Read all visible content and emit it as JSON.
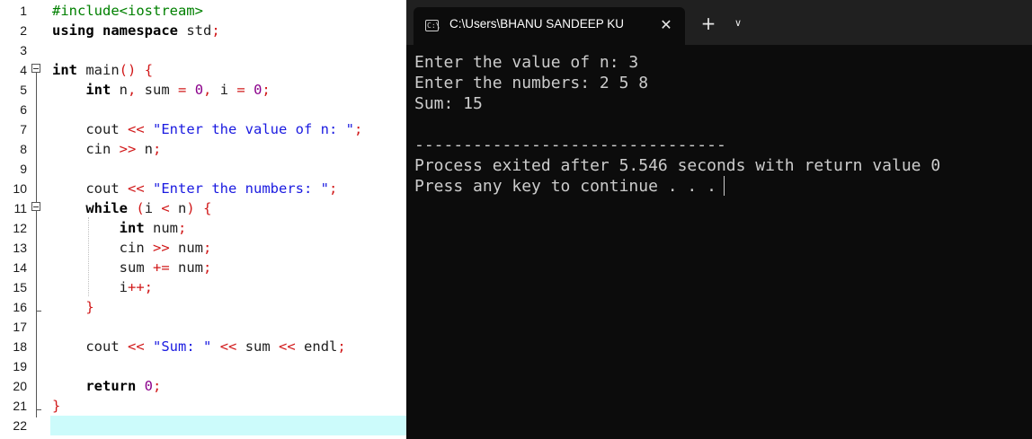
{
  "editor": {
    "lines": [
      {
        "n": "1",
        "tokens": [
          {
            "t": "#include<iostream>",
            "c": "pp"
          }
        ]
      },
      {
        "n": "2",
        "tokens": [
          {
            "t": "using namespace",
            "c": "kw"
          },
          {
            "t": " std",
            "c": "id"
          },
          {
            "t": ";",
            "c": "op"
          }
        ]
      },
      {
        "n": "3",
        "tokens": []
      },
      {
        "n": "4",
        "tokens": [
          {
            "t": "int",
            "c": "kw"
          },
          {
            "t": " main",
            "c": "id"
          },
          {
            "t": "()",
            "c": "op"
          },
          {
            "t": " ",
            "c": "id"
          },
          {
            "t": "{",
            "c": "op"
          }
        ]
      },
      {
        "n": "5",
        "tokens": [
          {
            "t": "    ",
            "c": "id"
          },
          {
            "t": "int",
            "c": "kw"
          },
          {
            "t": " n",
            "c": "id"
          },
          {
            "t": ",",
            "c": "op"
          },
          {
            "t": " sum ",
            "c": "id"
          },
          {
            "t": "=",
            "c": "op"
          },
          {
            "t": " ",
            "c": "id"
          },
          {
            "t": "0",
            "c": "num"
          },
          {
            "t": ",",
            "c": "op"
          },
          {
            "t": " i ",
            "c": "id"
          },
          {
            "t": "=",
            "c": "op"
          },
          {
            "t": " ",
            "c": "id"
          },
          {
            "t": "0",
            "c": "num"
          },
          {
            "t": ";",
            "c": "op"
          }
        ]
      },
      {
        "n": "6",
        "tokens": []
      },
      {
        "n": "7",
        "tokens": [
          {
            "t": "    cout ",
            "c": "id"
          },
          {
            "t": "<<",
            "c": "op"
          },
          {
            "t": " ",
            "c": "id"
          },
          {
            "t": "\"Enter the value of n: \"",
            "c": "str"
          },
          {
            "t": ";",
            "c": "op"
          }
        ]
      },
      {
        "n": "8",
        "tokens": [
          {
            "t": "    cin ",
            "c": "id"
          },
          {
            "t": ">>",
            "c": "op"
          },
          {
            "t": " n",
            "c": "id"
          },
          {
            "t": ";",
            "c": "op"
          }
        ]
      },
      {
        "n": "9",
        "tokens": []
      },
      {
        "n": "10",
        "tokens": [
          {
            "t": "    cout ",
            "c": "id"
          },
          {
            "t": "<<",
            "c": "op"
          },
          {
            "t": " ",
            "c": "id"
          },
          {
            "t": "\"Enter the numbers: \"",
            "c": "str"
          },
          {
            "t": ";",
            "c": "op"
          }
        ]
      },
      {
        "n": "11",
        "tokens": [
          {
            "t": "    ",
            "c": "id"
          },
          {
            "t": "while",
            "c": "kw"
          },
          {
            "t": " ",
            "c": "id"
          },
          {
            "t": "(",
            "c": "op"
          },
          {
            "t": "i ",
            "c": "id"
          },
          {
            "t": "<",
            "c": "op"
          },
          {
            "t": " n",
            "c": "id"
          },
          {
            "t": ")",
            "c": "op"
          },
          {
            "t": " ",
            "c": "id"
          },
          {
            "t": "{",
            "c": "op"
          }
        ]
      },
      {
        "n": "12",
        "tokens": [
          {
            "t": "        ",
            "c": "id"
          },
          {
            "t": "int",
            "c": "kw"
          },
          {
            "t": " num",
            "c": "id"
          },
          {
            "t": ";",
            "c": "op"
          }
        ]
      },
      {
        "n": "13",
        "tokens": [
          {
            "t": "        cin ",
            "c": "id"
          },
          {
            "t": ">>",
            "c": "op"
          },
          {
            "t": " num",
            "c": "id"
          },
          {
            "t": ";",
            "c": "op"
          }
        ]
      },
      {
        "n": "14",
        "tokens": [
          {
            "t": "        sum ",
            "c": "id"
          },
          {
            "t": "+=",
            "c": "op"
          },
          {
            "t": " num",
            "c": "id"
          },
          {
            "t": ";",
            "c": "op"
          }
        ]
      },
      {
        "n": "15",
        "tokens": [
          {
            "t": "        i",
            "c": "id"
          },
          {
            "t": "++;",
            "c": "op"
          }
        ]
      },
      {
        "n": "16",
        "tokens": [
          {
            "t": "    ",
            "c": "id"
          },
          {
            "t": "}",
            "c": "op"
          }
        ]
      },
      {
        "n": "17",
        "tokens": []
      },
      {
        "n": "18",
        "tokens": [
          {
            "t": "    cout ",
            "c": "id"
          },
          {
            "t": "<<",
            "c": "op"
          },
          {
            "t": " ",
            "c": "id"
          },
          {
            "t": "\"Sum: \"",
            "c": "str"
          },
          {
            "t": " ",
            "c": "id"
          },
          {
            "t": "<<",
            "c": "op"
          },
          {
            "t": " sum ",
            "c": "id"
          },
          {
            "t": "<<",
            "c": "op"
          },
          {
            "t": " endl",
            "c": "id"
          },
          {
            "t": ";",
            "c": "op"
          }
        ]
      },
      {
        "n": "19",
        "tokens": []
      },
      {
        "n": "20",
        "tokens": [
          {
            "t": "    ",
            "c": "id"
          },
          {
            "t": "return",
            "c": "kw"
          },
          {
            "t": " ",
            "c": "id"
          },
          {
            "t": "0",
            "c": "num"
          },
          {
            "t": ";",
            "c": "op"
          }
        ]
      },
      {
        "n": "21",
        "tokens": [
          {
            "t": "}",
            "c": "op"
          }
        ]
      },
      {
        "n": "22",
        "tokens": []
      }
    ],
    "current_line": "22",
    "colors": {
      "preprocessor": "#008000",
      "keyword": "#000000",
      "operator": "#d1191a",
      "number": "#8b008b",
      "string": "#1a1ae0",
      "current_line_bg": "#ccfbfb"
    }
  },
  "terminal": {
    "tab_icon": "cmd-icon",
    "tab_icon_glyph": "C:\\",
    "tab_title": "C:\\Users\\BHANU SANDEEP KU",
    "close_glyph": "✕",
    "new_tab_glyph": "+",
    "dropdown_glyph": "∨",
    "output": [
      "Enter the value of n: 3",
      "Enter the numbers: 2 5 8",
      "Sum: 15",
      "",
      "--------------------------------",
      "Process exited after 5.546 seconds with return value 0",
      "Press any key to continue . . ."
    ],
    "colors": {
      "background": "#0c0c0c",
      "text": "#cccccc",
      "tabbar": "#202020"
    }
  }
}
